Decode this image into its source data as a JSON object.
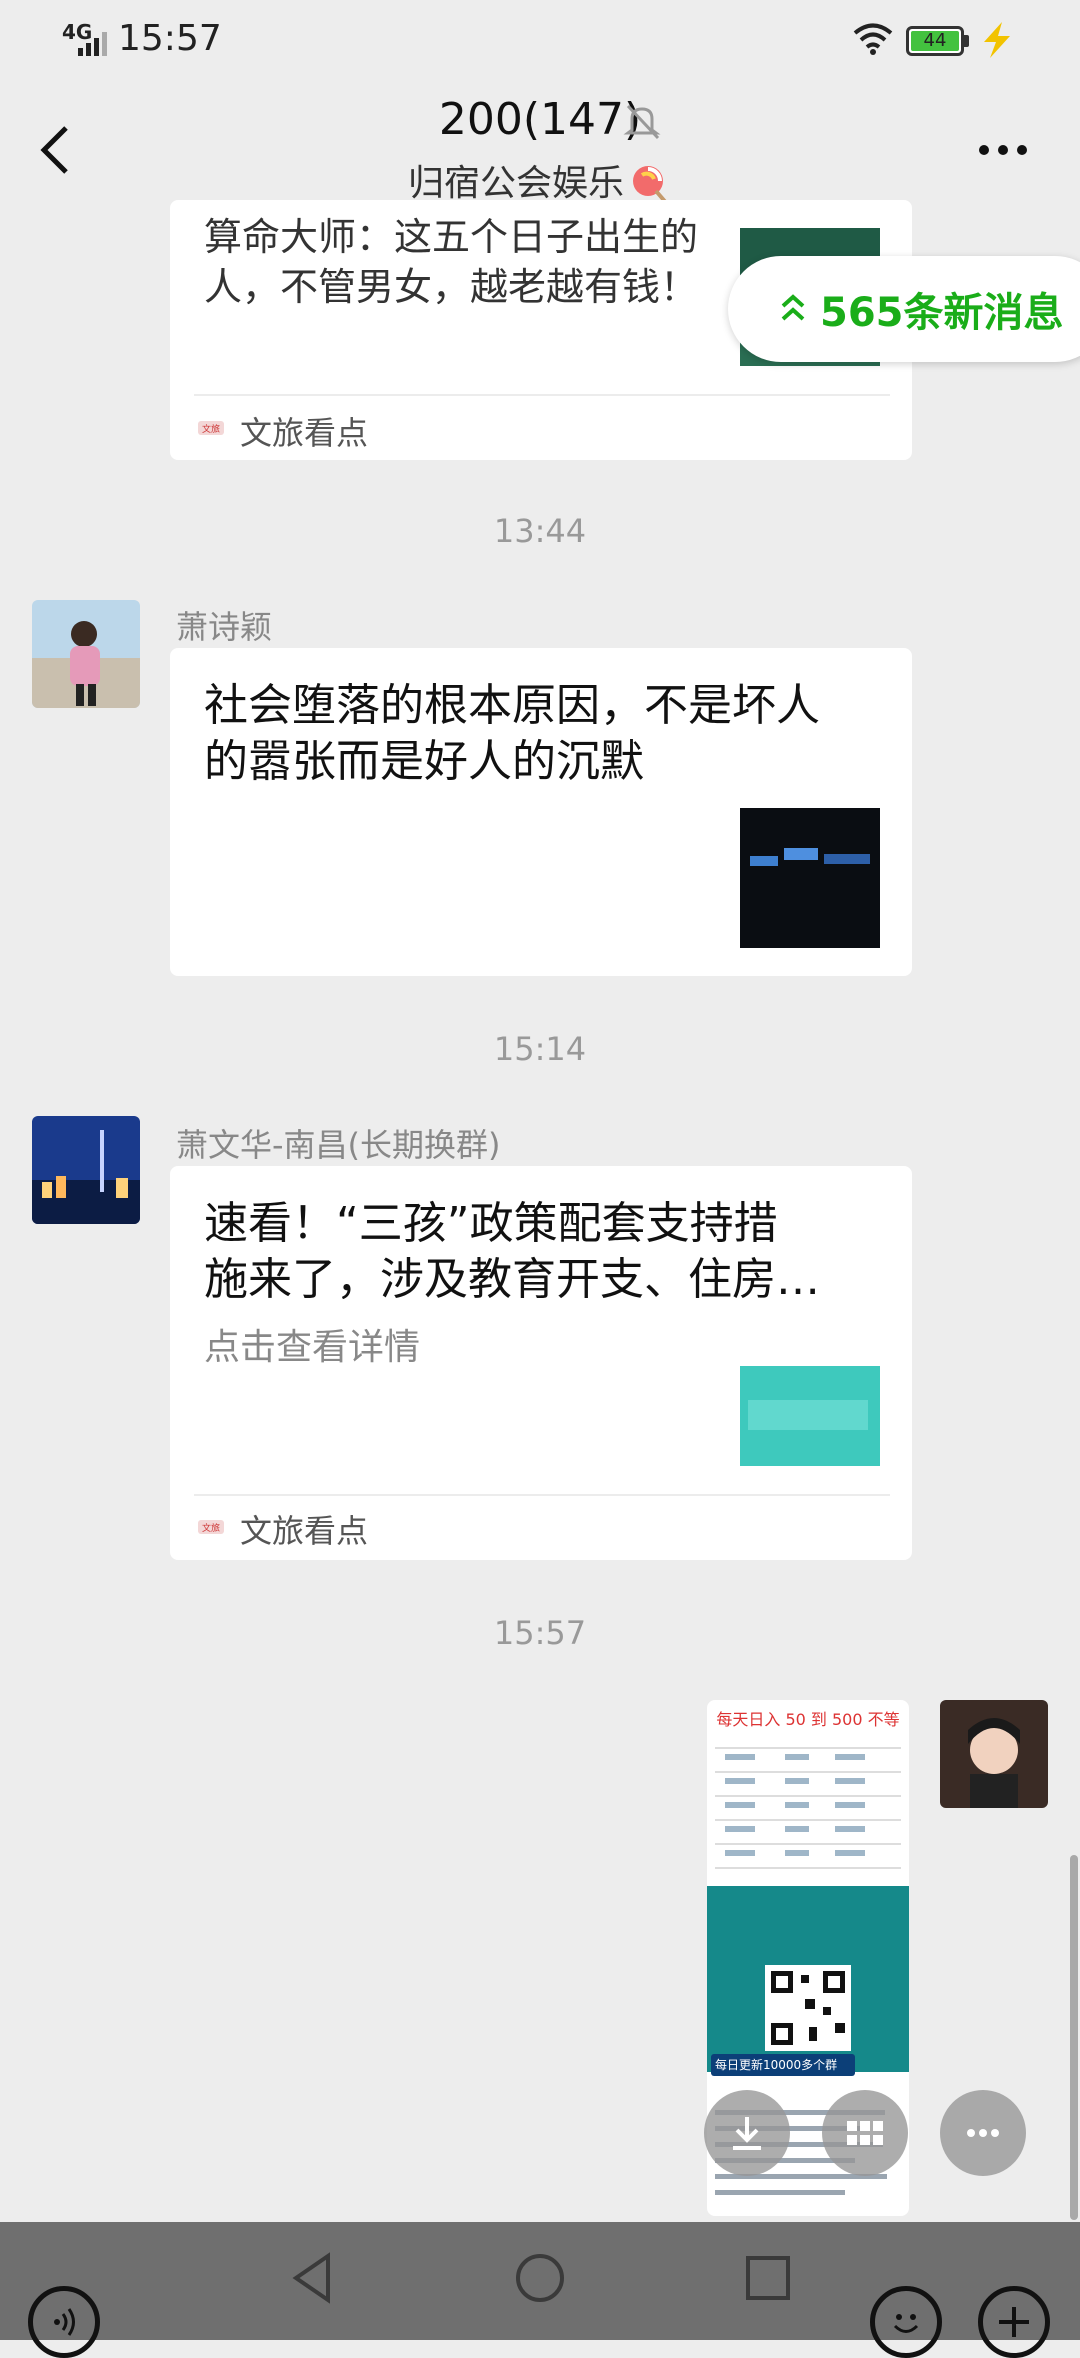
{
  "status_bar": {
    "network": "4G",
    "time": "15:57",
    "battery": "44",
    "icons": [
      "signal-icon",
      "wifi-icon",
      "battery-icon",
      "charging-icon"
    ]
  },
  "header": {
    "title": "200(147)",
    "subtitle": "归宿公会娱乐",
    "icons": [
      "back-icon",
      "mute-icon",
      "lollipop-icon",
      "more-icon"
    ]
  },
  "new_messages": {
    "label": "565条新消息",
    "icon": "double-chevron-up-icon"
  },
  "messages": [
    {
      "type": "article",
      "title": "算命大师：这五个日子出生的人，不管男女，越老越有钱！",
      "title_lines": [
        "算命大师：这五个日子出生的",
        "人，不管男女，越老越有钱！"
      ],
      "source": "文旅看点"
    },
    {
      "type": "timestamp",
      "time": "13:44"
    },
    {
      "type": "article",
      "sender": "萧诗颖",
      "title": "社会堕落的根本原因，不是坏人的嚣张而是好人的沉默",
      "title_lines": [
        "社会堕落的根本原因，不是坏人",
        "的嚣张而是好人的沉默"
      ]
    },
    {
      "type": "timestamp",
      "time": "15:14"
    },
    {
      "type": "article",
      "sender": "萧文华-南昌(长期换群)",
      "title": "速看！“三孩”政策配套支持措施来了，涉及教育开支、住房…",
      "title_lines": [
        "速看！“三孩”政策配套支持措",
        "施来了，涉及教育开支、住房…"
      ],
      "description": "点击查看详情",
      "source": "文旅看点"
    },
    {
      "type": "timestamp",
      "time": "15:57"
    },
    {
      "type": "image",
      "from_self": true,
      "image_text": [
        "每天日入 50 到 500 不等",
        "每日更新10000多个群"
      ]
    }
  ],
  "bottom_toolbar": {
    "buttons": [
      "voice-icon",
      "back-triangle-icon",
      "home-circle-icon",
      "recents-square-icon",
      "emoji-icon",
      "plus-icon"
    ]
  },
  "floating_buttons": [
    "download-icon",
    "grid-icon",
    "more-dots-icon"
  ],
  "colors": {
    "background": "#ededed",
    "bubble": "#ffffff",
    "accent": "#1aad19",
    "timestamp": "#999999"
  }
}
